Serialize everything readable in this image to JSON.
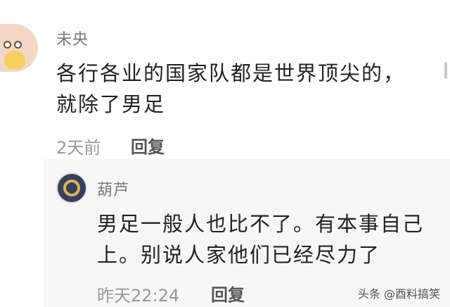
{
  "comment": {
    "username": "未央",
    "text_line1": "各行各业的国家队都是世界顶尖的，",
    "text_line2": "就除了男足",
    "time": "2天前",
    "reply_label": "回复"
  },
  "reply": {
    "username": "葫芦",
    "text_line1": "男足一般人也比不了。有本事自己",
    "text_line2": "上。别说人家他们已经尽力了",
    "time": "昨天22:24",
    "reply_label": "回复"
  },
  "watermark": "头条 @酉料搞笑"
}
